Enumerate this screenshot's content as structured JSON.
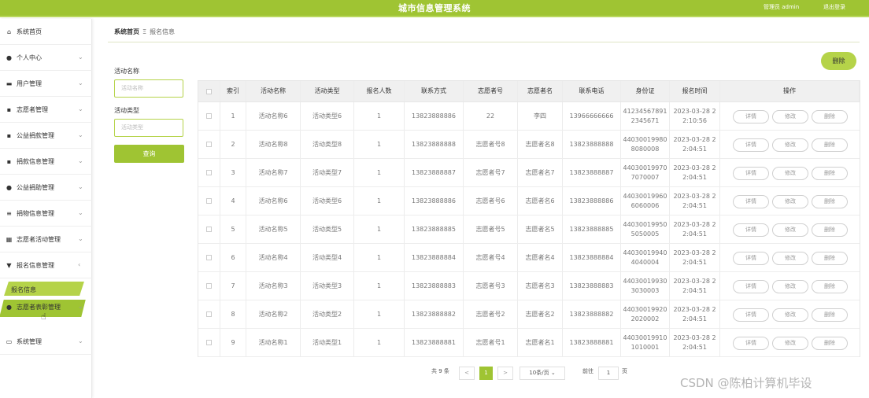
{
  "header": {
    "title": "城市信息管理系统",
    "admin": "管理员 admin",
    "logout": "退出登录"
  },
  "sidebar": {
    "items": [
      {
        "label": "系统首页",
        "icon": "home-icon"
      },
      {
        "label": "个人中心",
        "icon": "user-icon"
      },
      {
        "label": "用户管理",
        "icon": "user-group-icon"
      },
      {
        "label": "志愿者管理",
        "icon": "grid-icon"
      },
      {
        "label": "公益捐款管理",
        "icon": "grid-icon"
      },
      {
        "label": "捐款信息管理",
        "icon": "grid-icon"
      },
      {
        "label": "公益捐助管理",
        "icon": "user-icon"
      },
      {
        "label": "捐物信息管理",
        "icon": "list-icon"
      },
      {
        "label": "志愿者活动管理",
        "icon": "calendar-icon"
      },
      {
        "label": "报名信息管理",
        "icon": "clipboard-icon"
      },
      {
        "label": "志愿者表彰管理",
        "icon": "user-icon"
      },
      {
        "label": "系统管理",
        "icon": "monitor-icon"
      }
    ],
    "sub_item": "报名信息"
  },
  "breadcrumb": {
    "home": "系统首页",
    "sep": "Ξ",
    "current": "报名信息"
  },
  "search": {
    "activity_name_label": "活动名称",
    "activity_name_placeholder": "活动名称",
    "activity_type_label": "活动类型",
    "activity_type_placeholder": "活动类型",
    "query_button": "查询"
  },
  "actions": {
    "delete_button": "删除"
  },
  "table": {
    "headers": [
      "索引",
      "活动名称",
      "活动类型",
      "报名人数",
      "联系方式",
      "志愿者号",
      "志愿者名",
      "联系电话",
      "身份证",
      "报名时间",
      "操作"
    ],
    "rows": [
      {
        "index": "1",
        "name": "活动名称6",
        "type": "活动类型6",
        "count": "1",
        "contact": "13823888886",
        "vol_no": "22",
        "vol_name": "李四",
        "phone": "13966666666",
        "id_line1": "41234567891",
        "id_line2": "2345671",
        "time_line1": "2023-03-28 2",
        "time_line2": "2:10:56"
      },
      {
        "index": "2",
        "name": "活动名称8",
        "type": "活动类型8",
        "count": "1",
        "contact": "13823888888",
        "vol_no": "志愿者号8",
        "vol_name": "志愿者名8",
        "phone": "13823888888",
        "id_line1": "44030019980",
        "id_line2": "8080008",
        "time_line1": "2023-03-28 2",
        "time_line2": "2:04:51"
      },
      {
        "index": "3",
        "name": "活动名称7",
        "type": "活动类型7",
        "count": "1",
        "contact": "13823888887",
        "vol_no": "志愿者号7",
        "vol_name": "志愿者名7",
        "phone": "13823888887",
        "id_line1": "44030019970",
        "id_line2": "7070007",
        "time_line1": "2023-03-28 2",
        "time_line2": "2:04:51"
      },
      {
        "index": "4",
        "name": "活动名称6",
        "type": "活动类型6",
        "count": "1",
        "contact": "13823888886",
        "vol_no": "志愿者号6",
        "vol_name": "志愿者名6",
        "phone": "13823888886",
        "id_line1": "44030019960",
        "id_line2": "6060006",
        "time_line1": "2023-03-28 2",
        "time_line2": "2:04:51"
      },
      {
        "index": "5",
        "name": "活动名称5",
        "type": "活动类型5",
        "count": "1",
        "contact": "13823888885",
        "vol_no": "志愿者号5",
        "vol_name": "志愿者名5",
        "phone": "13823888885",
        "id_line1": "44030019950",
        "id_line2": "5050005",
        "time_line1": "2023-03-28 2",
        "time_line2": "2:04:51"
      },
      {
        "index": "6",
        "name": "活动名称4",
        "type": "活动类型4",
        "count": "1",
        "contact": "13823888884",
        "vol_no": "志愿者号4",
        "vol_name": "志愿者名4",
        "phone": "13823888884",
        "id_line1": "44030019940",
        "id_line2": "4040004",
        "time_line1": "2023-03-28 2",
        "time_line2": "2:04:51"
      },
      {
        "index": "7",
        "name": "活动名称3",
        "type": "活动类型3",
        "count": "1",
        "contact": "13823888883",
        "vol_no": "志愿者号3",
        "vol_name": "志愿者名3",
        "phone": "13823888883",
        "id_line1": "44030019930",
        "id_line2": "3030003",
        "time_line1": "2023-03-28 2",
        "time_line2": "2:04:51"
      },
      {
        "index": "8",
        "name": "活动名称2",
        "type": "活动类型2",
        "count": "1",
        "contact": "13823888882",
        "vol_no": "志愿者号2",
        "vol_name": "志愿者名2",
        "phone": "13823888882",
        "id_line1": "44030019920",
        "id_line2": "2020002",
        "time_line1": "2023-03-28 2",
        "time_line2": "2:04:51"
      },
      {
        "index": "9",
        "name": "活动名称1",
        "type": "活动类型1",
        "count": "1",
        "contact": "13823888881",
        "vol_no": "志愿者号1",
        "vol_name": "志愿者名1",
        "phone": "13823888881",
        "id_line1": "44030019910",
        "id_line2": "1010001",
        "time_line1": "2023-03-28 2",
        "time_line2": "2:04:51"
      }
    ],
    "row_buttons": {
      "detail": "详情",
      "edit": "修改",
      "delete": "删除"
    }
  },
  "pagination": {
    "total": "共 9 条",
    "prev": "<",
    "current_page": "1",
    "next": ">",
    "page_size": "10条/页",
    "goto_label": "前往",
    "goto_value": "1",
    "page_suffix": "页"
  },
  "watermark": "CSDN @陈柏计算机毕设",
  "colors": {
    "accent": "#9fc433",
    "accent_light": "#b5d349"
  }
}
